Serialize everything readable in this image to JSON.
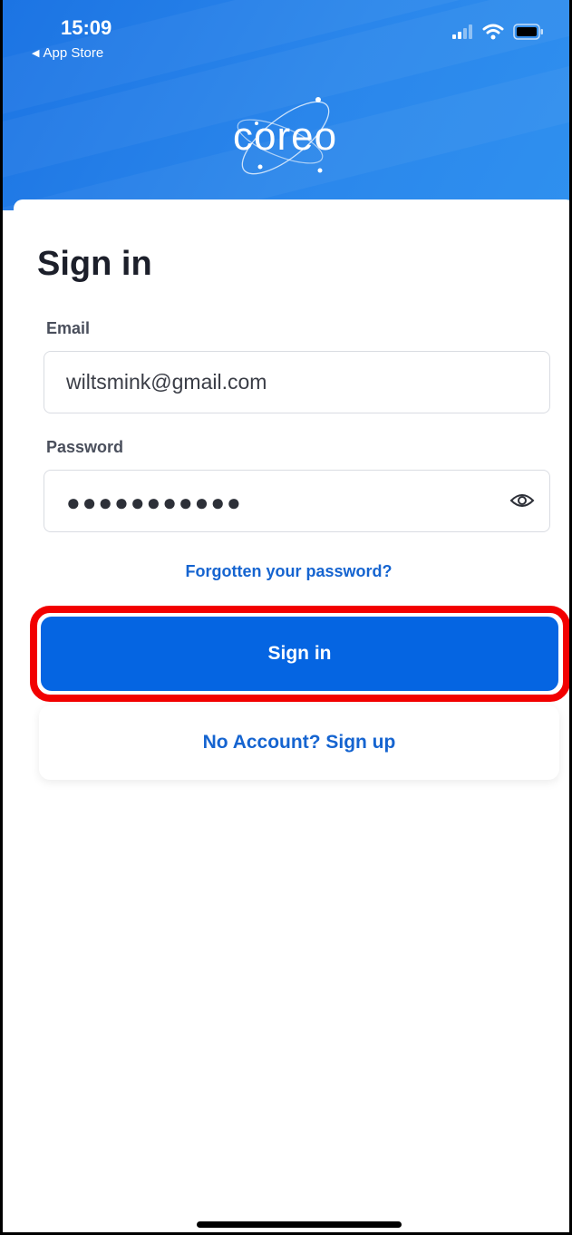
{
  "status_bar": {
    "time": "15:09",
    "back_label": "App Store",
    "icons": [
      "signal-icon",
      "wifi-icon",
      "battery-icon"
    ]
  },
  "header": {
    "logo_text": "coreo",
    "background_color": "#1c74e3"
  },
  "form": {
    "title": "Sign in",
    "email_label": "Email",
    "email_value": "wiltsmink@gmail.com",
    "password_label": "Password",
    "password_masked": "●●●●●●●●●●●",
    "password_toggle_icon": "eye-icon",
    "forgot_link": "Forgotten your password?"
  },
  "actions": {
    "sign_in_label": "Sign in",
    "sign_up_label": "No Account? Sign up",
    "primary_color": "#0565e2",
    "highlight_color": "#f20000"
  }
}
